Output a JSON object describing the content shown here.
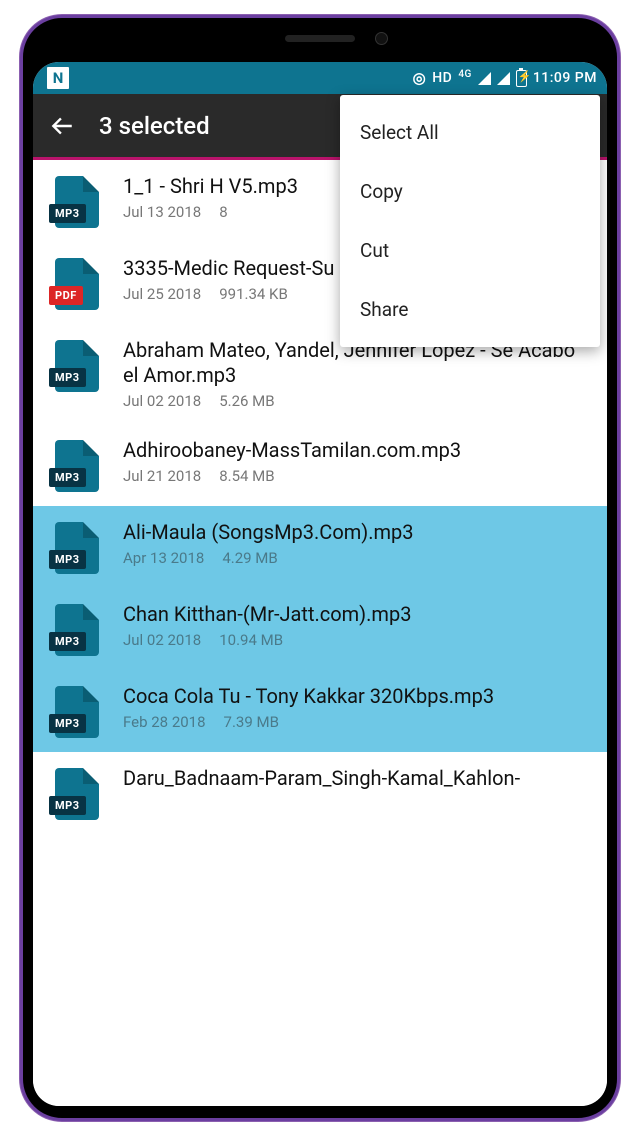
{
  "status": {
    "nav_icon": "N",
    "hd": "HD",
    "net": "4G",
    "time": "11:09 PM"
  },
  "appbar": {
    "title": "3 selected"
  },
  "menu": {
    "items": [
      "Select All",
      "Copy",
      "Cut",
      "Share"
    ]
  },
  "files": [
    {
      "ext": "MP3",
      "ext_class": "",
      "name": "1_1 - Shri H V5.mp3",
      "date": "Jul 13 2018",
      "size": "8",
      "selected": false
    },
    {
      "ext": "PDF",
      "ext_class": "pdf",
      "name": "3335-Medic Request-Su",
      "date": "Jul 25 2018",
      "size": "991.34 KB",
      "selected": false
    },
    {
      "ext": "MP3",
      "ext_class": "",
      "name": "Abraham Mateo, Yandel, Jennifer Lopez - Se Acabó el Amor.mp3",
      "date": "Jul 02 2018",
      "size": "5.26 MB",
      "selected": false
    },
    {
      "ext": "MP3",
      "ext_class": "",
      "name": "Adhiroobaney-MassTamilan.com.mp3",
      "date": "Jul 21 2018",
      "size": "8.54 MB",
      "selected": false
    },
    {
      "ext": "MP3",
      "ext_class": "",
      "name": "Ali-Maula (SongsMp3.Com).mp3",
      "date": "Apr 13 2018",
      "size": "4.29 MB",
      "selected": true
    },
    {
      "ext": "MP3",
      "ext_class": "",
      "name": "Chan Kitthan-(Mr-Jatt.com).mp3",
      "date": "Jul 02 2018",
      "size": "10.94 MB",
      "selected": true
    },
    {
      "ext": "MP3",
      "ext_class": "",
      "name": "Coca Cola Tu - Tony Kakkar 320Kbps.mp3",
      "date": "Feb 28 2018",
      "size": "7.39 MB",
      "selected": true
    },
    {
      "ext": "MP3",
      "ext_class": "",
      "name": "Daru_Badnaam-Param_Singh-Kamal_Kahlon-",
      "date": "",
      "size": "",
      "selected": false
    }
  ]
}
